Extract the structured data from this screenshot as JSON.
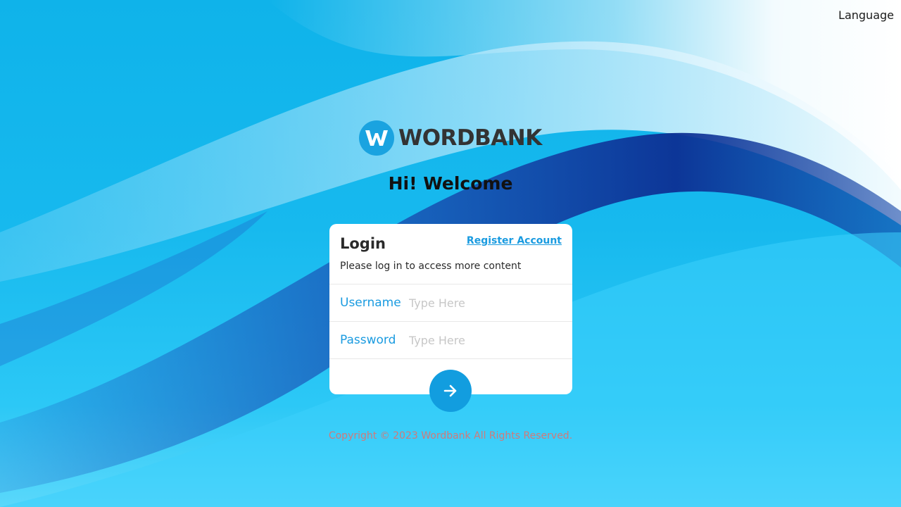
{
  "header": {
    "language_label": "Language"
  },
  "brand": {
    "logo_letter": "W",
    "logo_name": "WORDBANK"
  },
  "welcome": "Hi! Welcome",
  "login_card": {
    "title": "Login",
    "register_link": "Register Account",
    "subtitle": "Please log in to access more content",
    "username": {
      "label": "Username",
      "value": "",
      "placeholder": "Type Here"
    },
    "password": {
      "label": "Password",
      "value": "",
      "placeholder": "Type Here"
    },
    "submit_icon": "arrow-right-icon"
  },
  "footer": {
    "copyright": "Copyright © 2023 Wordbank All Rights Reserved."
  },
  "colors": {
    "accent": "#1a9be0",
    "brand_badge": "#1aa3e0",
    "submit_button": "#129ddf",
    "background_top": "#0fb3ea",
    "background_bottom": "#5ad8fb",
    "wave_dark": "#1a4fb3"
  }
}
